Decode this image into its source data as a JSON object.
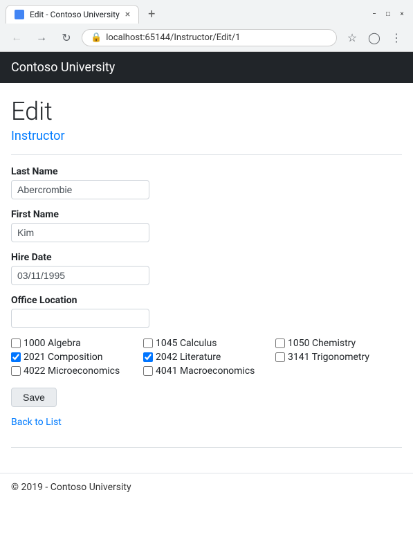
{
  "browser": {
    "tab_title": "Edit - Contoso University",
    "tab_close": "×",
    "new_tab": "+",
    "url": "localhost:65144/Instructor/Edit/1",
    "window_controls": [
      "−",
      "□",
      "×"
    ]
  },
  "header": {
    "app_title": "Contoso University",
    "btn_label": ""
  },
  "page": {
    "title": "Edit",
    "subtitle": "Instructor"
  },
  "form": {
    "last_name_label": "Last Name",
    "last_name_value": "Abercrombie",
    "first_name_label": "First Name",
    "first_name_value": "Kim",
    "hire_date_label": "Hire Date",
    "hire_date_value": "03/11/1995",
    "office_location_label": "Office Location",
    "office_location_value": ""
  },
  "courses": [
    {
      "id": "1000",
      "name": "Algebra",
      "checked": false
    },
    {
      "id": "1045",
      "name": "Calculus",
      "checked": false
    },
    {
      "id": "1050",
      "name": "Chemistry",
      "checked": false
    },
    {
      "id": "2021",
      "name": "Composition",
      "checked": true
    },
    {
      "id": "2042",
      "name": "Literature",
      "checked": true
    },
    {
      "id": "3141",
      "name": "Trigonometry",
      "checked": false
    },
    {
      "id": "4022",
      "name": "Microeconomics",
      "checked": false
    },
    {
      "id": "4041",
      "name": "Macroeconomics",
      "checked": false
    }
  ],
  "buttons": {
    "save_label": "Save"
  },
  "links": {
    "back_label": "Back to List"
  },
  "footer": {
    "text": "© 2019 - Contoso University"
  }
}
